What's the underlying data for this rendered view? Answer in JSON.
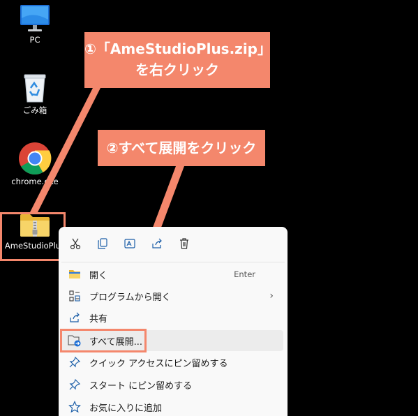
{
  "desktop": {
    "icons": [
      {
        "label": "PC"
      },
      {
        "label": "ごみ箱"
      },
      {
        "label": "chrome.exe"
      },
      {
        "label": "AmeStudioPlus"
      }
    ]
  },
  "callouts": {
    "step1_line1": "①「AmeStudioPlus.zip」",
    "step1_line2": "を右クリック",
    "step2": "②すべて展開をクリック"
  },
  "context_menu": {
    "toolbar": [
      "cut-icon",
      "copy-icon",
      "rename-icon",
      "share-icon",
      "delete-icon"
    ],
    "items": [
      {
        "label": "開く",
        "shortcut": "Enter",
        "icon": "folder-open-icon"
      },
      {
        "label": "プログラムから開く",
        "submenu": "›",
        "icon": "open-with-icon"
      },
      {
        "label": "共有",
        "icon": "share-icon"
      },
      {
        "label": "すべて展開...",
        "icon": "extract-all-icon"
      },
      {
        "label": "クイック アクセスにピン留めする",
        "icon": "pin-icon"
      },
      {
        "label": "スタート にピン留めする",
        "icon": "pin-icon"
      },
      {
        "label": "お気に入りに追加",
        "icon": "star-icon"
      }
    ]
  },
  "colors": {
    "accent": "#f4876c",
    "menu_bg": "#f9f9f9",
    "highlight": "#ececec"
  }
}
